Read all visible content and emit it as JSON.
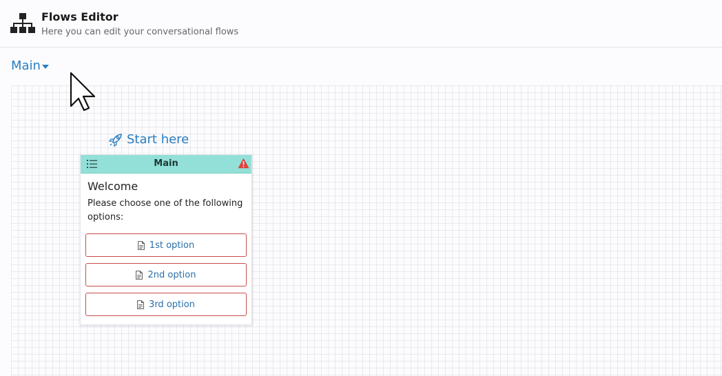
{
  "header": {
    "title": "Flows Editor",
    "subtitle": "Here you can edit your conversational flows",
    "icon": "sitemap-icon"
  },
  "flow_selector": {
    "selected": "Main",
    "icon": "caret-down-icon"
  },
  "canvas": {
    "start_label": "Start here",
    "start_icon": "rocket-icon",
    "node": {
      "title": "Main",
      "type_icon": "list-icon",
      "status_icon": "warning-icon",
      "heading": "Welcome",
      "text": "Please choose one of the following options:",
      "options": [
        {
          "label": "1st option",
          "icon": "document-icon"
        },
        {
          "label": "2nd option",
          "icon": "document-icon"
        },
        {
          "label": "3rd option",
          "icon": "document-icon"
        }
      ]
    }
  },
  "colors": {
    "accent": "#2a7dc0",
    "node_header": "#93e0d8",
    "option_border": "#c94a4a",
    "warning": "#e0423a"
  }
}
